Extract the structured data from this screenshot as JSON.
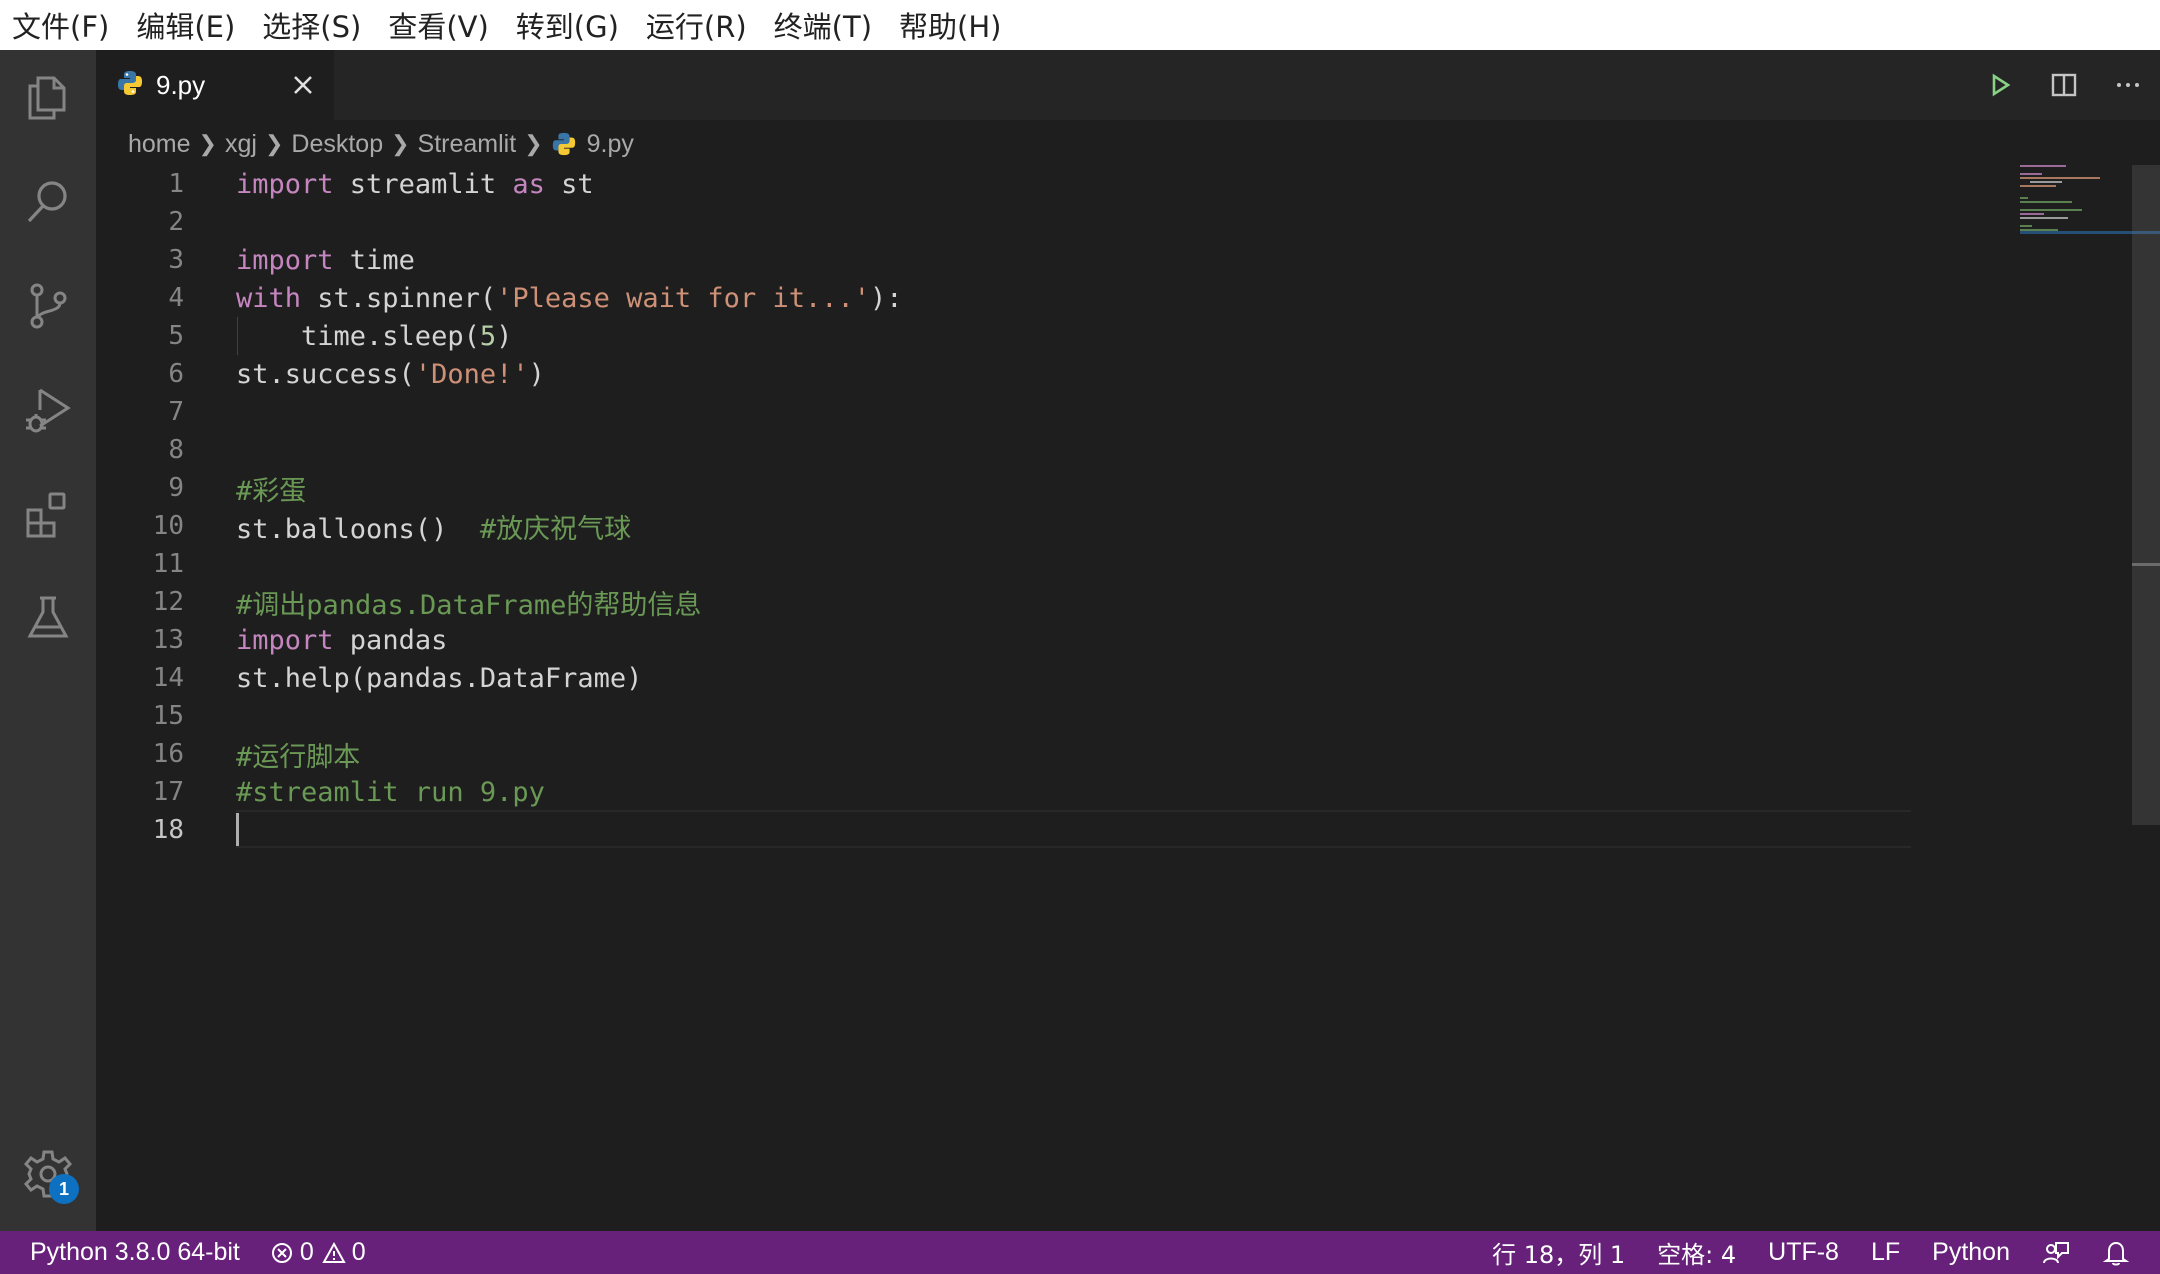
{
  "menubar": {
    "items": [
      "文件(F)",
      "编辑(E)",
      "选择(S)",
      "查看(V)",
      "转到(G)",
      "运行(R)",
      "终端(T)",
      "帮助(H)"
    ]
  },
  "activitybar": {
    "icons": [
      "explorer-icon",
      "search-icon",
      "source-control-icon",
      "run-debug-icon",
      "extensions-icon",
      "testing-icon",
      "settings-gear-icon"
    ],
    "settings_badge": "1"
  },
  "tab": {
    "label": "9.py",
    "icon": "python-icon"
  },
  "editor_actions": [
    "run-icon",
    "split-editor-icon",
    "more-icon"
  ],
  "breadcrumb": {
    "parts": [
      "home",
      "xgj",
      "Desktop",
      "Streamlit"
    ],
    "file": "9.py"
  },
  "editor": {
    "lines": [
      {
        "n": "1"
      },
      {
        "n": "2"
      },
      {
        "n": "3"
      },
      {
        "n": "4"
      },
      {
        "n": "5"
      },
      {
        "n": "6"
      },
      {
        "n": "7"
      },
      {
        "n": "8"
      },
      {
        "n": "9"
      },
      {
        "n": "10"
      },
      {
        "n": "11"
      },
      {
        "n": "12"
      },
      {
        "n": "13"
      },
      {
        "n": "14"
      },
      {
        "n": "15"
      },
      {
        "n": "16"
      },
      {
        "n": "17"
      },
      {
        "n": "18"
      }
    ],
    "code": {
      "l1_import": "import",
      "l1_rest": " streamlit ",
      "l1_as": "as",
      "l1_st": " st",
      "l3_import": "import",
      "l3_rest": " time",
      "l4_with": "with",
      "l4_a": " st.spinner(",
      "l4_str": "'Please wait for it...'",
      "l4_b": "):",
      "l5_a": "    time.sleep(",
      "l5_num": "5",
      "l5_b": ")",
      "l6_a": "st.success(",
      "l6_str": "'Done!'",
      "l6_b": ")",
      "l9_cmt": "#彩蛋",
      "l10_a": "st.balloons()  ",
      "l10_cmt": "#放庆祝气球",
      "l12_cmt": "#调出pandas.DataFrame的帮助信息",
      "l13_import": "import",
      "l13_rest": " pandas",
      "l14": "st.help(pandas.DataFrame)",
      "l16_cmt": "#运行脚本",
      "l17_cmt": "#streamlit run 9.py"
    }
  },
  "statusbar": {
    "interpreter": "Python 3.8.0 64-bit",
    "errors": "0",
    "warnings": "0",
    "cursor_position": "行 18，列 1",
    "indent": "空格: 4",
    "encoding": "UTF-8",
    "eol": "LF",
    "language": "Python"
  },
  "colors": {
    "statusbar": "#68217a",
    "keyword": "#c586c0",
    "string": "#ce9178",
    "number": "#b5cea8",
    "comment": "#6a9955"
  }
}
